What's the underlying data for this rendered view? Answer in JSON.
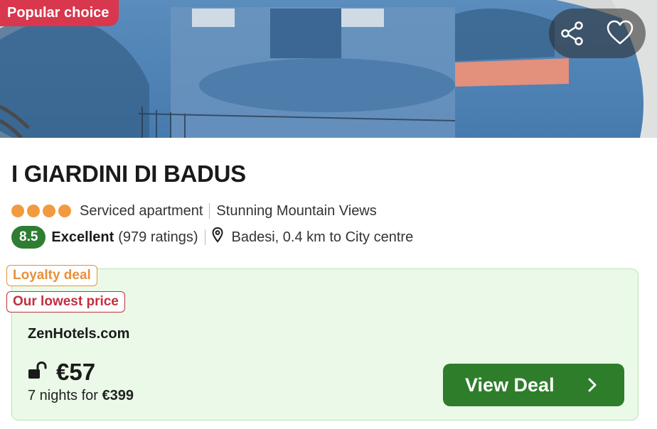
{
  "hero": {
    "badge": "Popular choice",
    "share_icon": "share-icon",
    "favorite_icon": "heart-icon"
  },
  "hotel": {
    "name": "I GIARDINI DI BADUS",
    "stars": 4,
    "type": "Serviced apartment",
    "highlight": "Stunning Mountain Views",
    "score": "8.5",
    "rating_word": "Excellent",
    "rating_count": "(979 ratings)",
    "location": "Badesi, 0.4 km to City centre"
  },
  "deal": {
    "tag_loyalty": "Loyalty deal",
    "tag_lowest": "Our lowest price",
    "provider": "ZenHotels.com",
    "price": "€57",
    "nights_prefix": "7 nights for",
    "nights_total": "€399",
    "button_label": "View Deal"
  },
  "colors": {
    "popular_badge": "#d9374d",
    "star": "#f29a3f",
    "score_badge": "#2e7d32",
    "deal_bg": "#ebfae8",
    "loyalty": "#e8903a",
    "lowest": "#c0303f",
    "cta": "#2e7d2a"
  }
}
